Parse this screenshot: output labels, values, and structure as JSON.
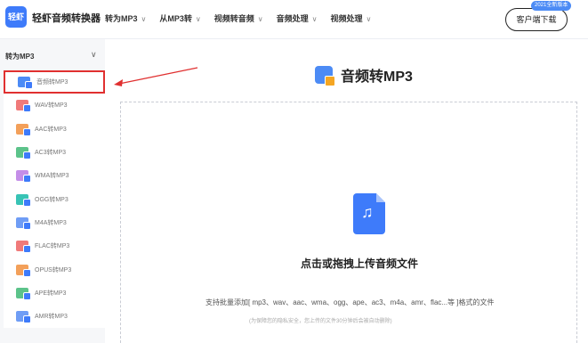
{
  "header": {
    "logo_mark": "轻虾",
    "logo_text": "轻虾音频转换器",
    "nav": [
      {
        "label": "转为MP3"
      },
      {
        "label": "从MP3转"
      },
      {
        "label": "视频转音频"
      },
      {
        "label": "音频处理"
      },
      {
        "label": "视频处理"
      }
    ],
    "download_button": "客户端下载",
    "download_badge": "2021全新版本"
  },
  "sidebar": {
    "section_label": "转为MP3",
    "items": [
      {
        "label": "音频转MP3",
        "color": "#4c8bf5",
        "active": true
      },
      {
        "label": "WAV转MP3",
        "color": "#f07a7a",
        "active": false
      },
      {
        "label": "AAC转MP3",
        "color": "#f3a05a",
        "active": false
      },
      {
        "label": "AC3转MP3",
        "color": "#5cc38a",
        "active": false
      },
      {
        "label": "WMA转MP3",
        "color": "#c48ee8",
        "active": false
      },
      {
        "label": "OGG转MP3",
        "color": "#38c3b5",
        "active": false
      },
      {
        "label": "M4A转MP3",
        "color": "#6f9df5",
        "active": false
      },
      {
        "label": "FLAC转MP3",
        "color": "#f07a7a",
        "active": false
      },
      {
        "label": "OPUS转MP3",
        "color": "#f3a05a",
        "active": false
      },
      {
        "label": "APE转MP3",
        "color": "#5cc38a",
        "active": false
      },
      {
        "label": "AMR转MP3",
        "color": "#6f9df5",
        "active": false
      }
    ]
  },
  "main": {
    "title": "音频转MP3",
    "upload_label": "点击或拖拽上传音频文件",
    "formats_hint": "支持批量添加[ mp3、wav、aac、wma、ogg、ape、ac3、m4a、amr、flac...等 ]格式的文件",
    "privacy_hint": "(为保障您的隐私安全，您上传的文件30分钟后会被自动删除)"
  },
  "colors": {
    "accent": "#3e7bfa",
    "highlight_box": "#e03030"
  }
}
